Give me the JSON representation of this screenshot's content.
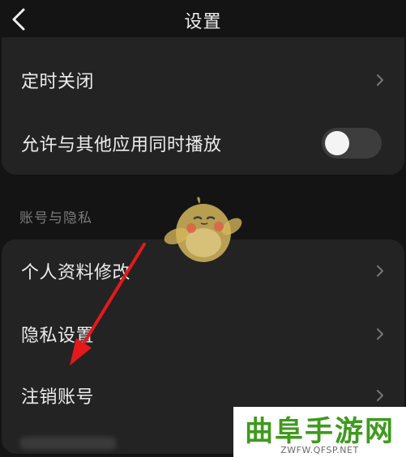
{
  "header": {
    "title": "设置",
    "back_icon": "chevron-left-icon"
  },
  "playback": {
    "items": [
      {
        "label": "定时关闭",
        "control": "chevron-right-icon"
      },
      {
        "label": "允许与其他应用同时播放",
        "control": "toggle",
        "on": false
      }
    ]
  },
  "account_section": {
    "title": "账号与隐私",
    "items": [
      {
        "label": "个人资料修改",
        "control": "chevron-right-icon"
      },
      {
        "label": "隐私设置",
        "control": "chevron-right-icon"
      },
      {
        "label": "注销账号",
        "control": "chevron-right-icon"
      }
    ]
  },
  "annotation": {
    "arrow_color": "#e3191c"
  },
  "watermark": {
    "main": "曲阜手游网",
    "sub": "ZWFW.QFSP.NET",
    "color": "#3f9a1e"
  }
}
